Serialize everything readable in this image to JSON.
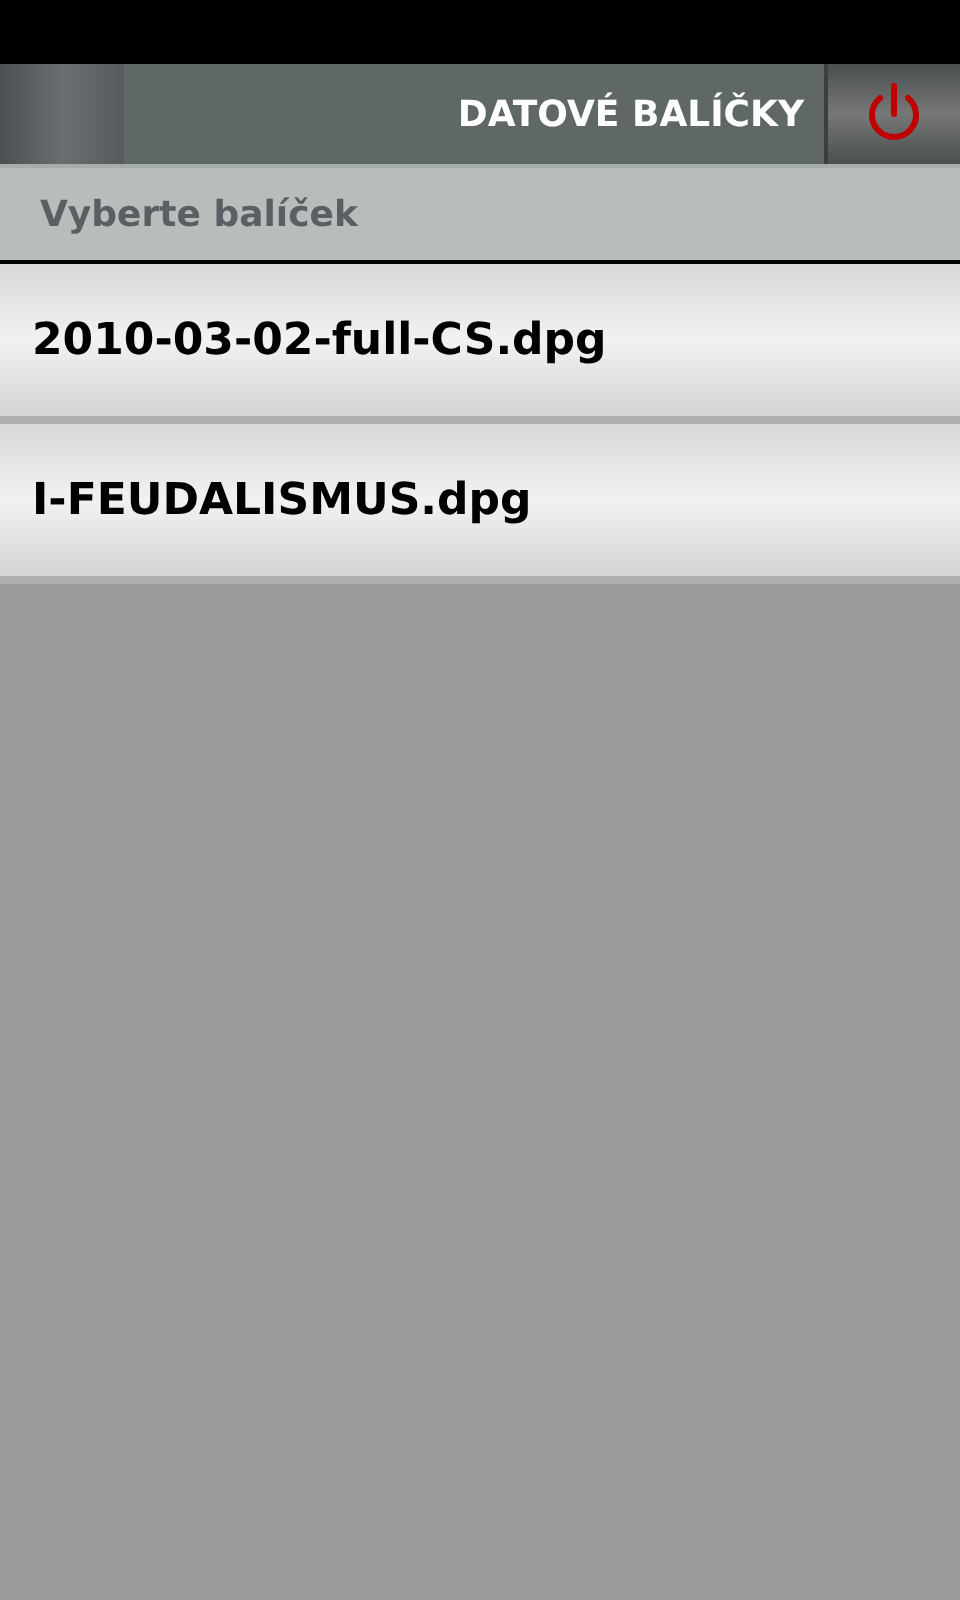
{
  "header": {
    "title": "DATOVÉ BALÍČKY"
  },
  "subheader": {
    "label": "Vyberte balíček"
  },
  "packages": [
    {
      "name": "2010-03-02-full-CS.dpg"
    },
    {
      "name": "I-FEUDALISMUS.dpg"
    }
  ]
}
